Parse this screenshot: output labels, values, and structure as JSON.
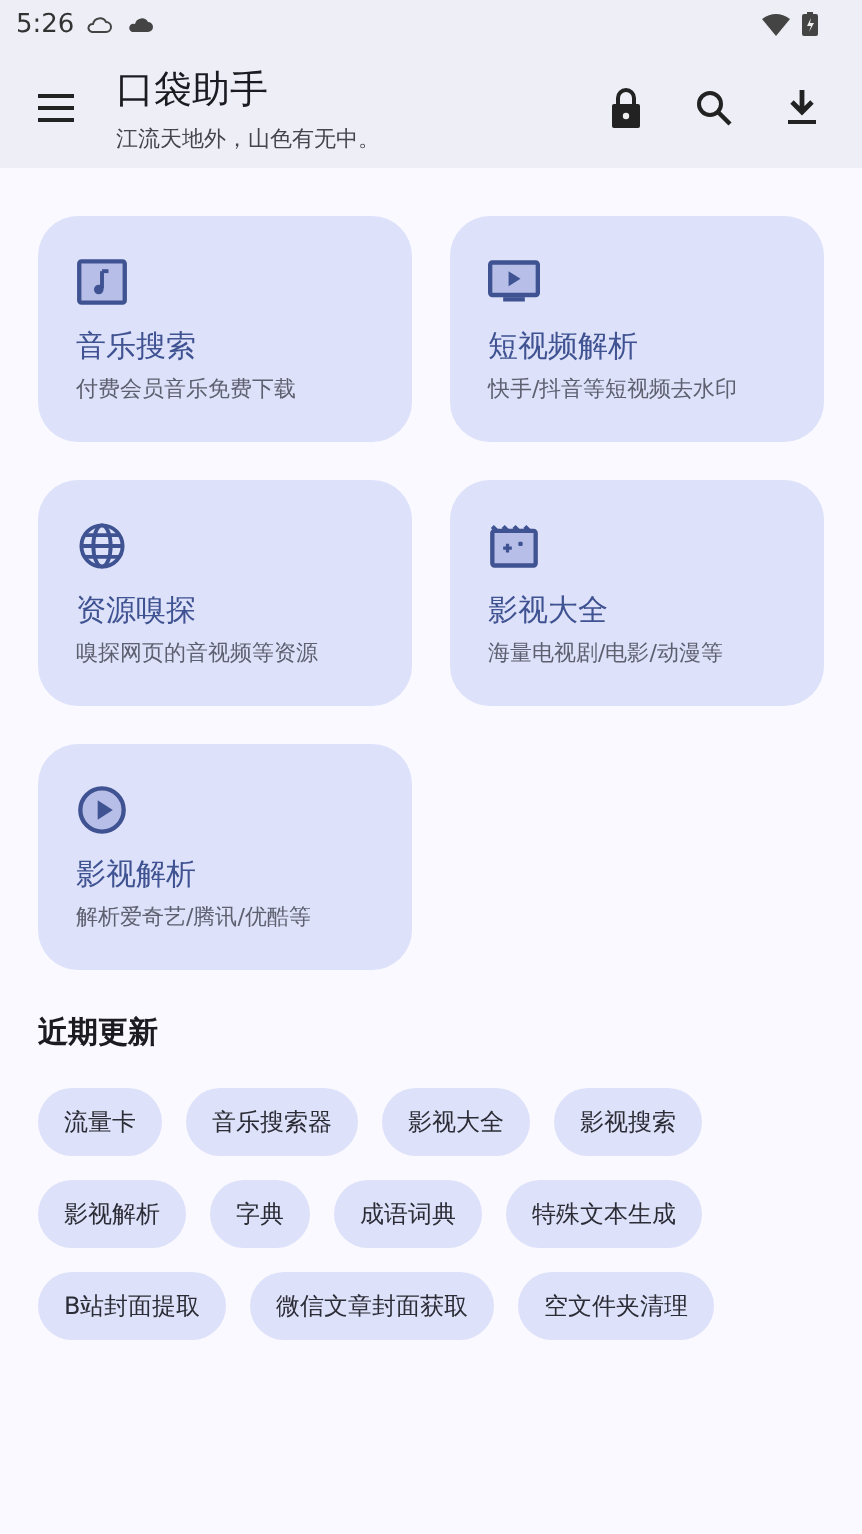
{
  "status_bar": {
    "time": "5:26"
  },
  "app_bar": {
    "title": "口袋助手",
    "subtitle": "江流天地外，山色有无中。"
  },
  "features": [
    {
      "title": "音乐搜索",
      "subtitle": "付费会员音乐免费下载"
    },
    {
      "title": "短视频解析",
      "subtitle": "快手/抖音等短视频去水印"
    },
    {
      "title": "资源嗅探",
      "subtitle": "嗅探网页的音视频等资源"
    },
    {
      "title": "影视大全",
      "subtitle": "海量电视剧/电影/动漫等"
    },
    {
      "title": "影视解析",
      "subtitle": "解析爱奇艺/腾讯/优酷等"
    }
  ],
  "recent": {
    "title": "近期更新",
    "items": [
      "流量卡",
      "音乐搜索器",
      "影视大全",
      "影视搜索",
      "影视解析",
      "字典",
      "成语词典",
      "特殊文本生成",
      "B站封面提取",
      "微信文章封面获取",
      "空文件夹清理"
    ]
  }
}
